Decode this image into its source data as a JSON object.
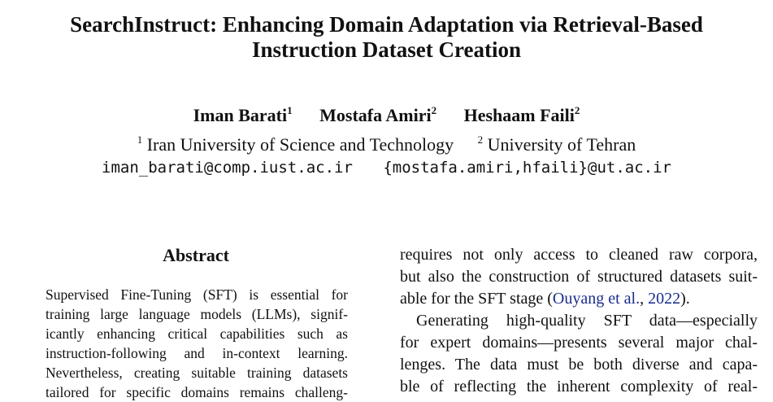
{
  "paper": {
    "title_line1": "SearchInstruct: Enhancing Domain Adaptation via Retrieval-Based",
    "title_line2": "Instruction Dataset Creation",
    "authors": [
      {
        "name": "Iman Barati",
        "sup": "1"
      },
      {
        "name": "Mostafa Amiri",
        "sup": "2"
      },
      {
        "name": "Heshaam Faili",
        "sup": "2"
      }
    ],
    "affiliations": [
      {
        "sup": "1",
        "name": "Iran University of Science and Technology"
      },
      {
        "sup": "2",
        "name": "University of Tehran"
      }
    ],
    "emails": [
      "iman_barati@comp.iust.ac.ir",
      "{mostafa.amiri,hfaili}@ut.ac.ir"
    ],
    "abstract_heading": "Abstract",
    "abstract_lines": [
      "Supervised Fine-Tuning (SFT) is essential for",
      "training large language models (LLMs), signif-",
      "icantly enhancing critical capabilities such as",
      "instruction-following and in-context learning.",
      "Nevertheless, creating suitable training datasets",
      "tailored for specific domains remains challeng-"
    ],
    "right_col": {
      "line1": "requires not only access to cleaned raw corpora,",
      "line2": "but also the construction of structured datasets suit-",
      "line3_pre": "able for the SFT stage (",
      "line3_cite_author": "Ouyang et al.",
      "line3_cite_sep": ", ",
      "line3_cite_year": "2022",
      "line3_post": ").",
      "line4": "Generating high-quality SFT data—especially",
      "line5": "for expert domains—presents several major chal-",
      "line6": "lenges.  The data must be both diverse and capa-",
      "line7": "ble of reflecting the inherent complexity of real-"
    }
  }
}
